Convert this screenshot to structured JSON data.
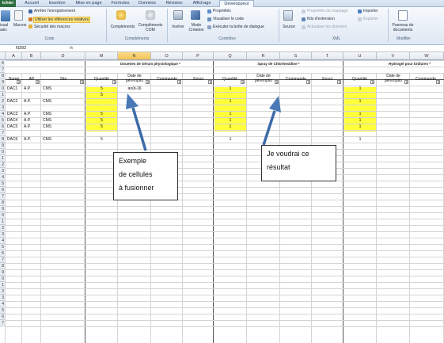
{
  "ribbon": {
    "tabs": [
      "ichier",
      "Accueil",
      "Insertion",
      "Mise en page",
      "Formules",
      "Données",
      "Révision",
      "Affichage",
      "Développeur"
    ],
    "active_tab": "Développeur",
    "code": {
      "visual_basic": "isual\nasic",
      "macros": "Macros",
      "record_macro": "Arrêter l'enregistrement",
      "relative_refs": "Utiliser les références relatives",
      "macro_security": "Sécurité des macros",
      "group_label": "Code"
    },
    "addins": {
      "complements": "Compléments",
      "com_complements": "Compléments\nCOM",
      "group_label": "Compléments"
    },
    "controls": {
      "insert": "Insérer",
      "design_mode": "Mode\nCréation",
      "properties": "Propriétés",
      "view_code": "Visualiser le code",
      "run_dialog": "Exécuter la boîte de dialogue",
      "group_label": "Contrôles"
    },
    "xml": {
      "source": "Source",
      "map_properties": "Propriétés du mappage",
      "expansion_packs": "Kits d'extension",
      "refresh_data": "Actualiser les données",
      "import": "Importer",
      "export": "Exporter",
      "group_label": "XML"
    },
    "modify": {
      "document_panel": "Panneau de\ndocuments",
      "group_label": "Modifier"
    }
  },
  "formula_bar": {
    "name_box": "N292",
    "fx": "fx"
  },
  "sheet": {
    "columns": [
      "A",
      "B",
      "D",
      "M",
      "N",
      "O",
      "P",
      "Q",
      "R",
      "S",
      "T",
      "U",
      "V",
      "W"
    ],
    "selected_column": "N",
    "row_numbers": [
      "6",
      "7",
      "8",
      "9",
      "0",
      "1",
      "2",
      "3",
      "4",
      "5",
      "6",
      "7",
      "8",
      "9",
      "0",
      "1",
      "2",
      "3",
      "4",
      "5",
      "6",
      "7",
      "8",
      "9",
      "0",
      "1",
      "2",
      "3",
      "4",
      "5",
      "6",
      "7",
      "8",
      "9",
      "0",
      "1",
      "2",
      "3",
      "4",
      "5",
      "6",
      "7"
    ],
    "sections": [
      "Douettes de Sérum physiologique *",
      "Spray de Chlorhexidine *",
      "Hydrogel pour brûlures *"
    ],
    "headers": {
      "num": "Numé",
      "ap": "AP",
      "site": "Site",
      "qty": "Quantité",
      "exp_date": "Date de\npéremptio",
      "order": "Commande",
      "send": "Envoi"
    },
    "rows": [
      {
        "num": "DAC1",
        "ap": "A.P.",
        "site": "CMS",
        "qty1": "5",
        "exp": "août-16",
        "qty2": "1",
        "qty3": "1"
      },
      {
        "num": "",
        "ap": "",
        "site": "",
        "qty1": "5",
        "exp": "",
        "qty2": "",
        "qty3": ""
      },
      {
        "num": "DAC2",
        "ap": "A.P.",
        "site": "CMS",
        "qty1": "",
        "exp": "",
        "qty2": "1",
        "qty3": "1"
      },
      {
        "num": "",
        "ap": "",
        "site": "",
        "qty1": "",
        "exp": "",
        "qty2": "",
        "qty3": ""
      },
      {
        "num": "DAC3",
        "ap": "A.P.",
        "site": "CMS",
        "qty1": "5",
        "exp": "",
        "qty2": "1",
        "qty3": "1"
      },
      {
        "num": "DAC4",
        "ap": "A.P.",
        "site": "CMS",
        "qty1": "5",
        "exp": "",
        "qty2": "1",
        "qty3": "1"
      },
      {
        "num": "DAC5",
        "ap": "A.P.",
        "site": "CMS",
        "qty1": "5",
        "exp": "",
        "qty2": "1",
        "qty3": "1"
      },
      {
        "num": "",
        "ap": "",
        "site": "",
        "qty1": "",
        "exp": "",
        "qty2": "",
        "qty3": ""
      },
      {
        "num": "DAC6",
        "ap": "A.P.",
        "site": "CMS",
        "qty1": "5",
        "exp": "",
        "qty2": "1",
        "qty3": "1"
      }
    ]
  },
  "annotations": {
    "left_note": [
      "Exemple",
      "de cellules",
      "à fusionner"
    ],
    "right_note": [
      "Je voudrai ce",
      "résultat"
    ]
  },
  "colors": {
    "highlight": "#ffff3c",
    "file_tab": "#2c6e3f",
    "arrow": "#4a79b8"
  }
}
